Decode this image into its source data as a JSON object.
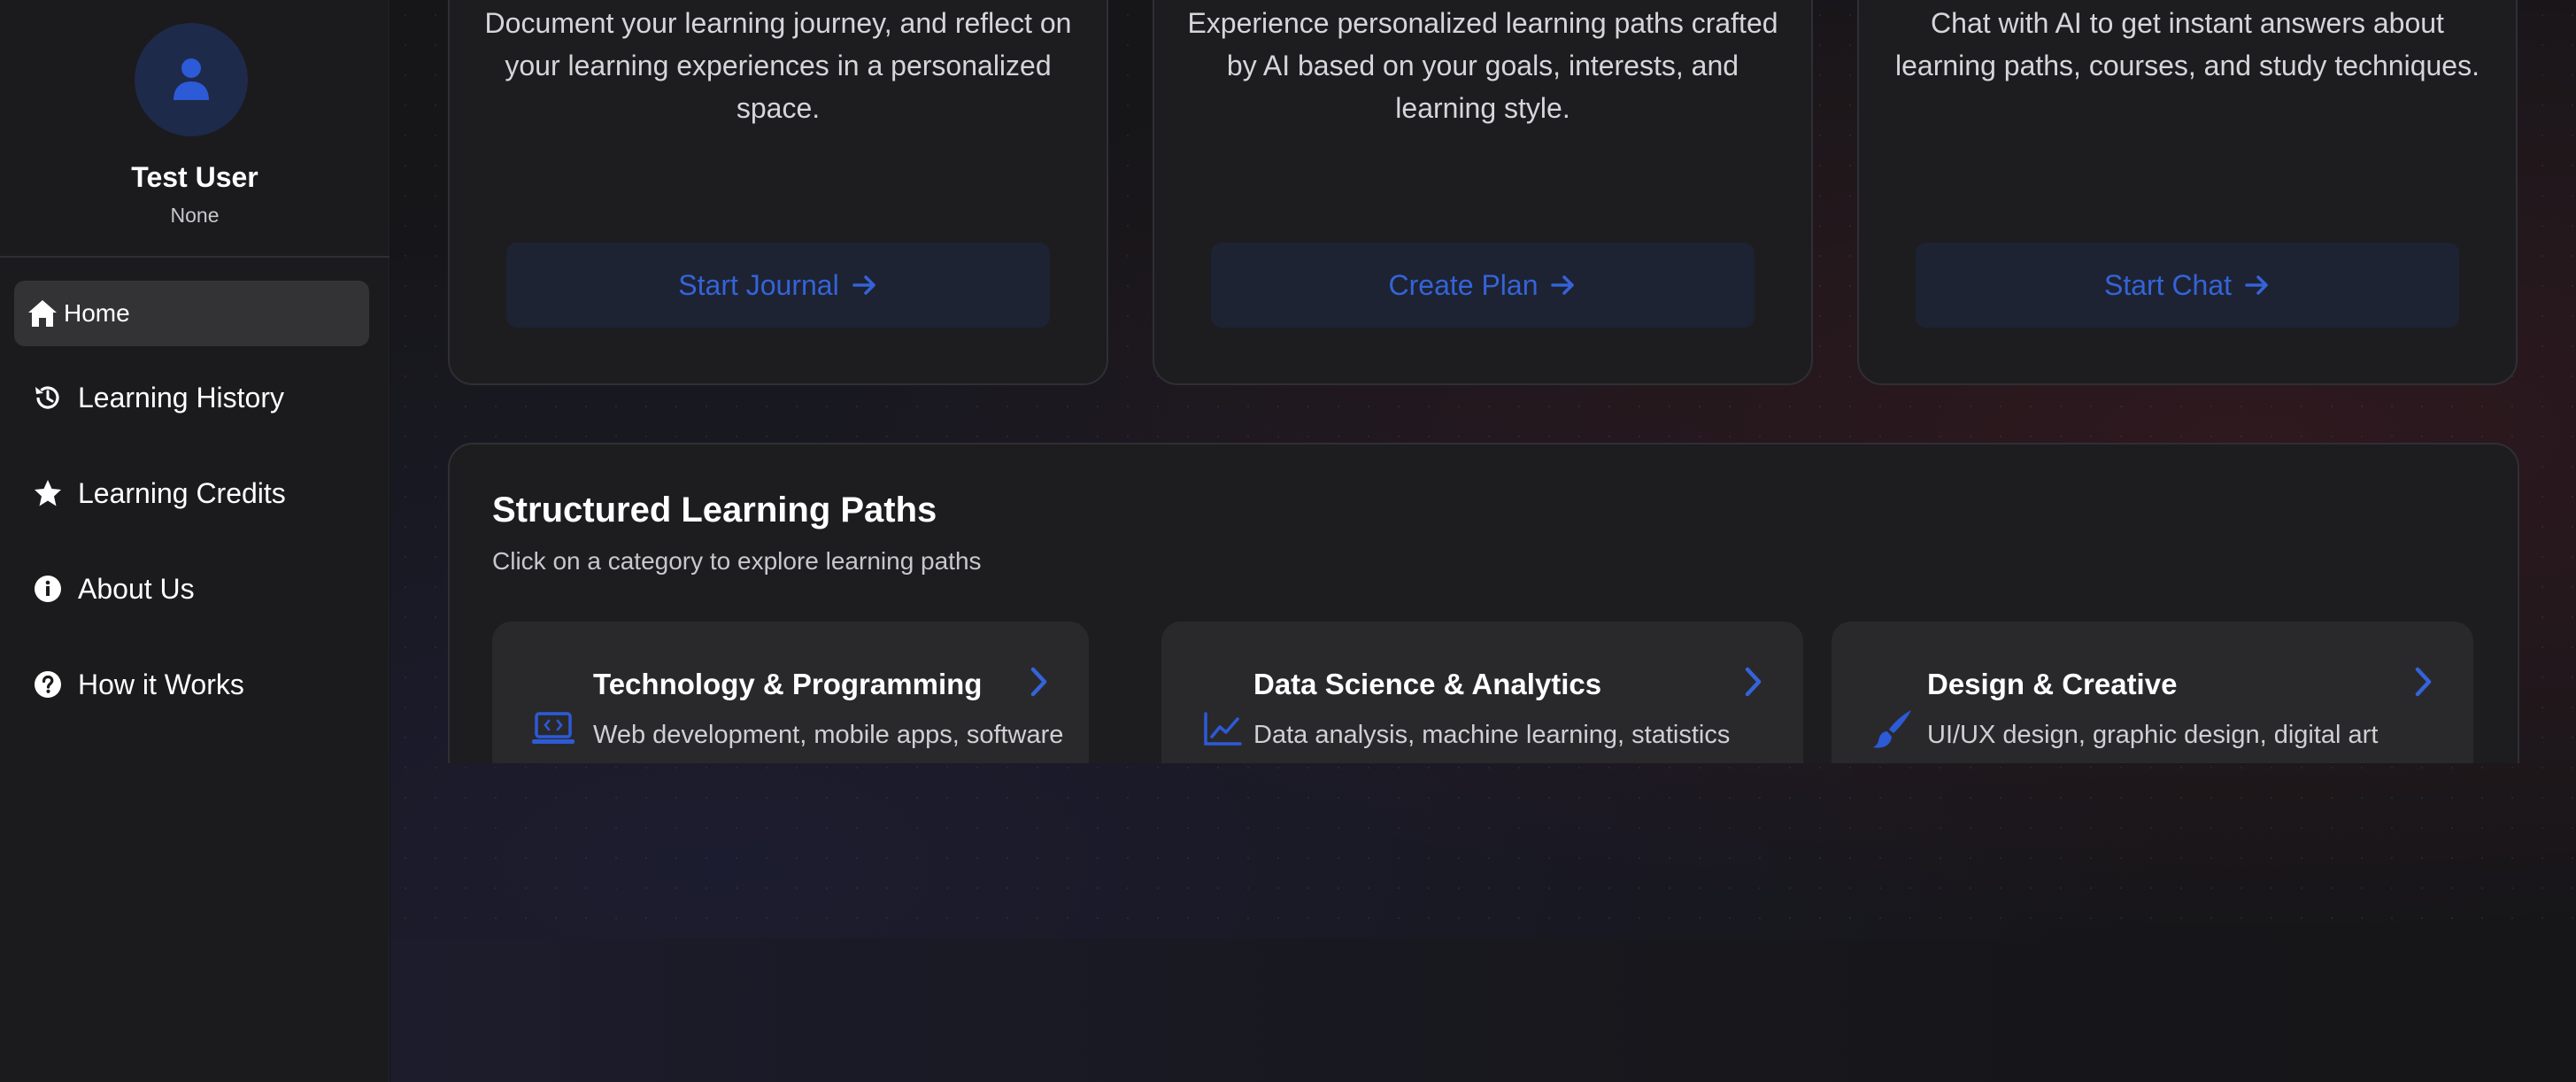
{
  "sidebar": {
    "user": {
      "name": "Test User",
      "subtitle": "None"
    },
    "items": [
      {
        "label": "Home",
        "icon": "home-icon",
        "active": true
      },
      {
        "label": "Learning History",
        "icon": "history-icon"
      },
      {
        "label": "Learning Credits",
        "icon": "star-icon"
      },
      {
        "label": "About Us",
        "icon": "info-icon"
      },
      {
        "label": "How it Works",
        "icon": "question-icon"
      }
    ]
  },
  "features": [
    {
      "description": "Document your learning journey, and reflect on your learning experiences in a personalized space.",
      "button": "Start Journal"
    },
    {
      "description": "Experience personalized learning paths crafted by AI based on your goals, interests, and learning style.",
      "button": "Create Plan"
    },
    {
      "description": "Chat with AI to get instant answers about learning paths, courses, and study techniques.",
      "button": "Start Chat"
    }
  ],
  "paths": {
    "title": "Structured Learning Paths",
    "subtitle": "Click on a category to explore learning paths",
    "categories": [
      {
        "title": "Technology & Programming",
        "description": "Web development, mobile apps, software",
        "icon": "laptop-code-icon"
      },
      {
        "title": "Data Science & Analytics",
        "description": "Data analysis, machine learning, statistics",
        "icon": "chart-line-icon"
      },
      {
        "title": "Design & Creative",
        "description": "UI/UX design, graphic design, digital art",
        "icon": "paintbrush-icon"
      }
    ]
  },
  "colors": {
    "accent": "#3563d8",
    "sidebar": "#1b1b1d",
    "card": "#1d1d20"
  }
}
